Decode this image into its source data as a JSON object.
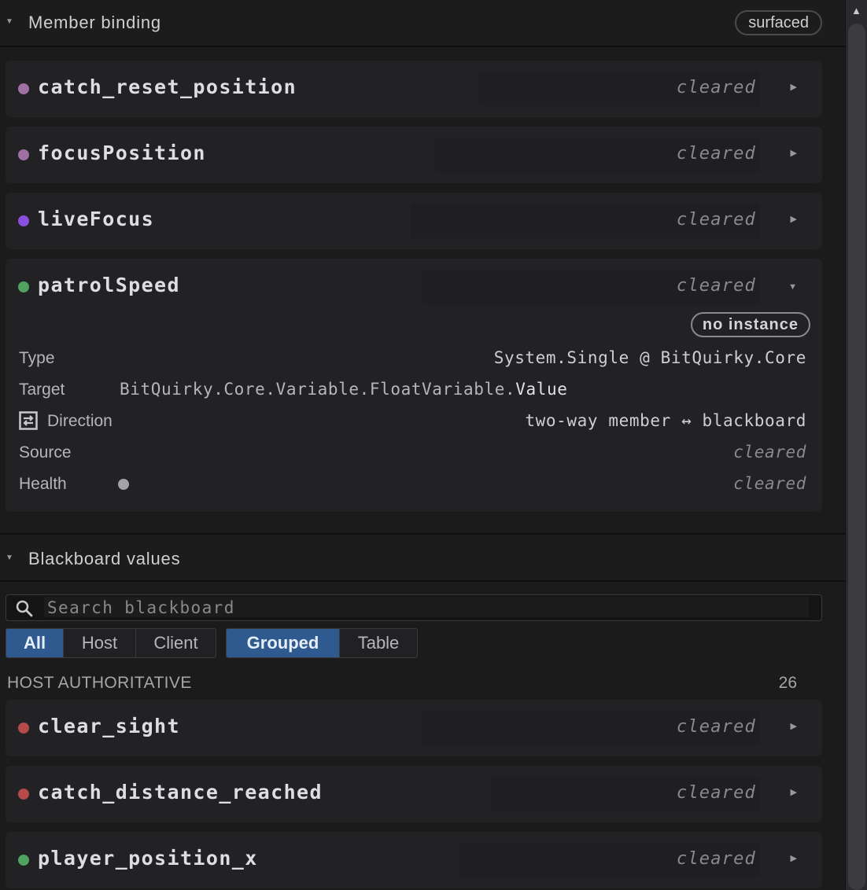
{
  "member_binding": {
    "title": "Member binding",
    "badge": "surfaced",
    "items": [
      {
        "name": "catch_reset_position",
        "value": "cleared",
        "dot_color": "#a06fa4"
      },
      {
        "name": "focusPosition",
        "value": "cleared",
        "dot_color": "#a06fa4"
      },
      {
        "name": "liveFocus",
        "value": "cleared",
        "dot_color": "#8b4fe0"
      },
      {
        "name": "patrolSpeed",
        "value": "cleared",
        "dot_color": "#4fa25f"
      }
    ],
    "expanded": {
      "status": "no instance",
      "type_label": "Type",
      "type_value": "System.Single @ BitQuirky.Core",
      "target_label": "Target",
      "target_value": "BitQuirky.Core.Variable.FloatVariable.",
      "target_member": "Value",
      "direction_label": "Direction",
      "direction_value": "two-way member ↔ blackboard",
      "source_label": "Source",
      "source_value": "cleared",
      "health_label": "Health",
      "health_value": "cleared"
    }
  },
  "blackboard": {
    "title": "Blackboard values",
    "search_placeholder": "Search blackboard",
    "filters": [
      "All",
      "Host",
      "Client"
    ],
    "active_filter": "All",
    "views": [
      "Grouped",
      "Table"
    ],
    "active_view": "Grouped",
    "group_label": "HOST AUTHORITATIVE",
    "group_count": "26",
    "items": [
      {
        "name": "clear_sight",
        "value": "cleared",
        "dot_color": "#b44a4a"
      },
      {
        "name": "catch_distance_reached",
        "value": "cleared",
        "dot_color": "#b44a4a"
      },
      {
        "name": "player_position_x",
        "value": "cleared",
        "dot_color": "#4fa25f"
      }
    ]
  },
  "colors": {
    "accent": "#2f5a8f",
    "background": "#1b1b1c",
    "card": "#222224"
  }
}
